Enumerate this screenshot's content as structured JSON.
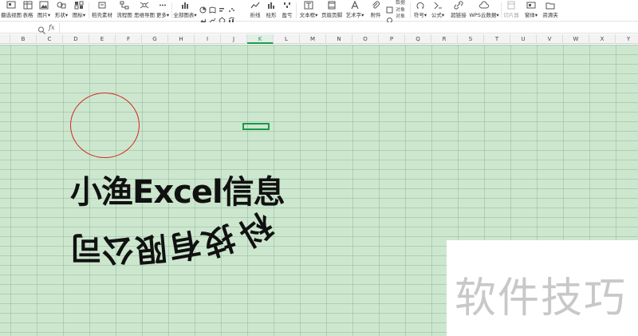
{
  "ribbon": {
    "items": [
      {
        "label": "摄选视图",
        "icon": "screenshot-icon"
      },
      {
        "label": "表格",
        "icon": "table-icon"
      },
      {
        "label": "图片▾",
        "icon": "picture-icon"
      },
      {
        "label": "形状▾",
        "icon": "shapes-icon"
      },
      {
        "label": "图标▾",
        "icon": "icons-icon"
      },
      {
        "label": "稻壳素材",
        "icon": "material-icon"
      },
      {
        "label": "流程图",
        "icon": "flowchart-icon"
      },
      {
        "label": "思维导图",
        "icon": "mindmap-icon"
      },
      {
        "label": "更多▾",
        "icon": "more-icon"
      },
      {
        "label": "全部图表▾",
        "icon": "all-charts-icon"
      },
      {
        "label": "折线",
        "icon": "line-chart-icon"
      },
      {
        "label": "柱形",
        "icon": "column-chart-icon"
      },
      {
        "label": "盈亏",
        "icon": "winloss-icon"
      },
      {
        "label": "文本框▾",
        "icon": "textbox-icon"
      },
      {
        "label": "页眉页脚",
        "icon": "header-footer-icon"
      },
      {
        "label": "艺术字▾",
        "icon": "wordart-icon"
      },
      {
        "label": "附件",
        "icon": "attachment-icon"
      },
      {
        "label": "对象",
        "icon": "object-icon"
      },
      {
        "label": "符号▾",
        "icon": "symbol-icon"
      },
      {
        "label": "公式▾",
        "icon": "formula-icon"
      },
      {
        "label": "超链接",
        "icon": "hyperlink-icon"
      },
      {
        "label": "WPS云数据▾",
        "icon": "cloud-data-icon"
      },
      {
        "label": "切片器",
        "icon": "slicer-icon"
      },
      {
        "label": "窗体▾",
        "icon": "form-icon"
      },
      {
        "label": "资源夹",
        "icon": "resource-icon"
      }
    ],
    "stack_label": "数据对象"
  },
  "formula_bar": {
    "name_box": "",
    "fx": "fx",
    "value": ""
  },
  "columns": [
    "B",
    "C",
    "D",
    "E",
    "F",
    "G",
    "H",
    "I",
    "J",
    "K",
    "L",
    "M",
    "N",
    "O",
    "P",
    "Q",
    "R",
    "S",
    "T",
    "U",
    "V",
    "W",
    "X",
    "Y"
  ],
  "active_column": "K",
  "wordart": {
    "line1": "小渔Excel信息",
    "line2_chars": [
      "科",
      "技",
      "有",
      "限",
      "公",
      "司"
    ]
  },
  "watermark": "软件技巧",
  "colors": {
    "grid_bg": "#cde7cf",
    "accent": "#1a9b48",
    "circle_stroke": "#d42a1e"
  }
}
